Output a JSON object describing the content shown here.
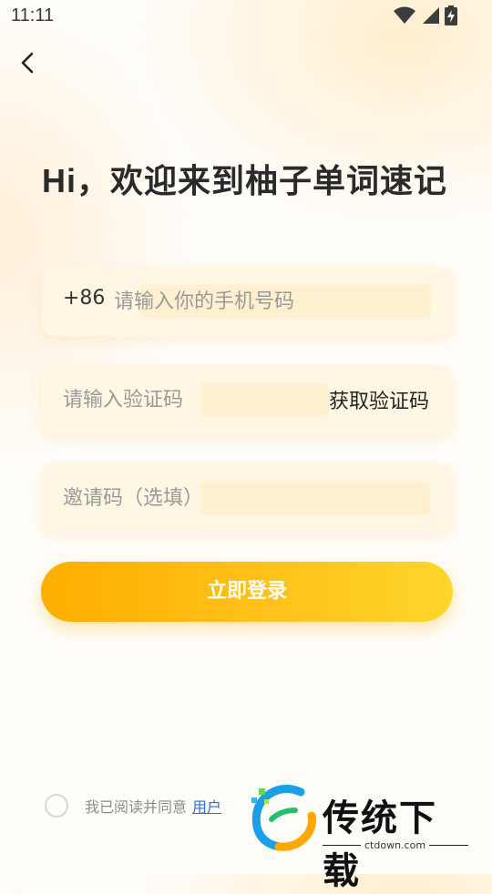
{
  "status_bar": {
    "time": "11:11",
    "icons": [
      "wifi-icon",
      "signal-icon",
      "battery-charging-icon"
    ]
  },
  "header": {
    "back_icon": "chevron-left-icon",
    "title": "Hi，欢迎来到柚子单词速记"
  },
  "form": {
    "phone": {
      "prefix": "+86",
      "placeholder": "请输入你的手机号码",
      "value": ""
    },
    "code": {
      "placeholder": "请输入验证码",
      "value": "",
      "get_code_label": "获取验证码"
    },
    "invite": {
      "placeholder": "邀请码（选填）",
      "value": ""
    },
    "login_label": "立即登录"
  },
  "agreement": {
    "checked": false,
    "text": "我已阅读并同意",
    "link": "用户"
  },
  "watermark": {
    "text": "传统下载",
    "url": "ctdown.com"
  },
  "colors": {
    "accent_start": "#ffae00",
    "accent_end": "#ffd62a",
    "field_bg": "#fff7e3",
    "link": "#2f6fd0"
  }
}
